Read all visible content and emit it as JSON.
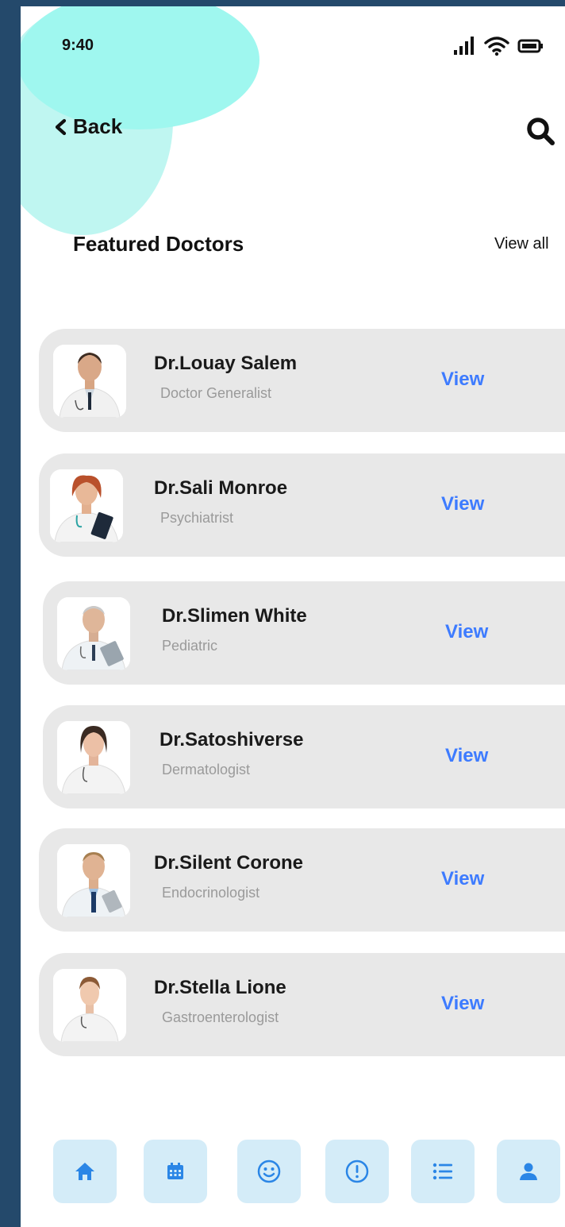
{
  "status_bar": {
    "time": "9:40"
  },
  "header": {
    "back_label": "Back"
  },
  "section": {
    "title": "Featured Doctors",
    "view_all_label": "View all"
  },
  "doctors": [
    {
      "name": "Dr.Louay Salem",
      "specialty": "Doctor Generalist",
      "action": "View"
    },
    {
      "name": "Dr.Sali Monroe",
      "specialty": "Psychiatrist",
      "action": "View"
    },
    {
      "name": "Dr.Slimen White",
      "specialty": "Pediatric",
      "action": "View"
    },
    {
      "name": "Dr.Satoshiverse",
      "specialty": "Dermatologist",
      "action": "View"
    },
    {
      "name": "Dr.Silent Corone",
      "specialty": "Endocrinologist",
      "action": "View"
    },
    {
      "name": "Dr.Stella Lione",
      "specialty": "Gastroenterologist",
      "action": "View"
    }
  ],
  "bottom_nav": [
    {
      "icon": "home-icon"
    },
    {
      "icon": "calendar-icon"
    },
    {
      "icon": "smiley-icon"
    },
    {
      "icon": "alert-icon"
    },
    {
      "icon": "list-icon"
    },
    {
      "icon": "user-icon"
    }
  ],
  "colors": {
    "accent": "#3d7bff",
    "card": "#e8e8e8",
    "nav_tile": "#d4ecf8",
    "blob": "#9ff7ef",
    "frame": "#24496b"
  }
}
